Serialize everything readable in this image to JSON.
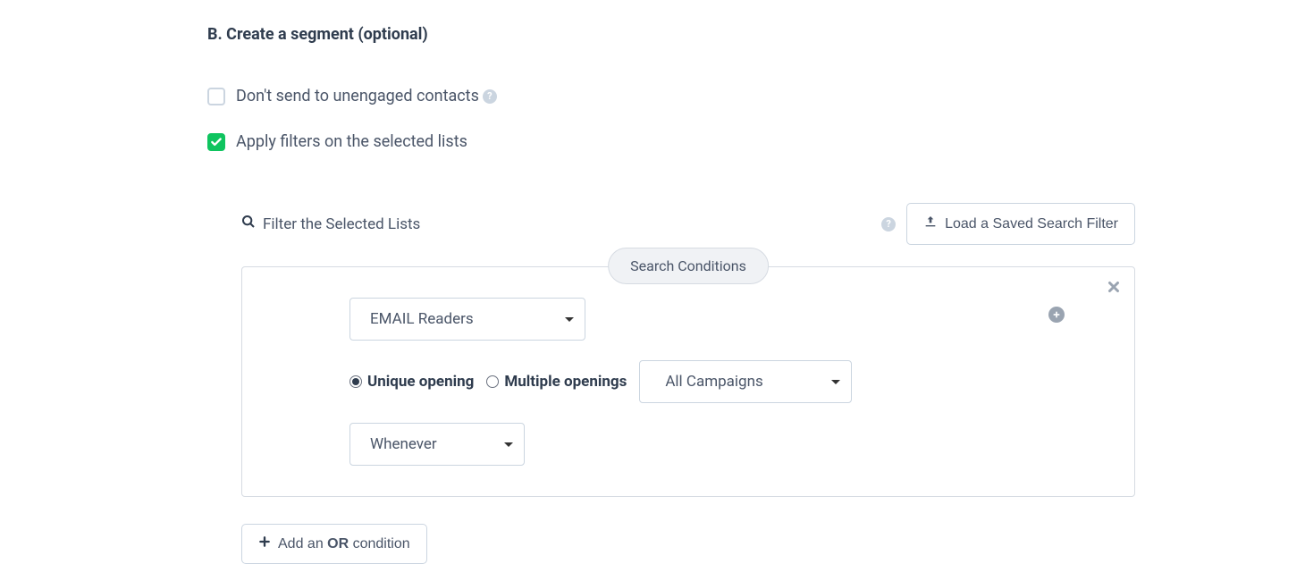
{
  "section": {
    "title": "B. Create a segment (optional)"
  },
  "checkboxes": {
    "unengaged": {
      "label": "Don't send to unengaged contacts",
      "checked": false
    },
    "applyFilters": {
      "label": "Apply filters on the selected lists",
      "checked": true
    }
  },
  "filter": {
    "header_label": "Filter the Selected Lists",
    "load_button": "Load a Saved Search Filter",
    "legend": "Search Conditions",
    "attr_select": "EMAIL Readers",
    "radio_unique": "Unique opening",
    "radio_multiple": "Multiple openings",
    "campaigns_select": "All Campaigns",
    "time_select": "Whenever"
  },
  "add_or": {
    "prefix": "Add an ",
    "bold": "OR",
    "suffix": " condition"
  }
}
